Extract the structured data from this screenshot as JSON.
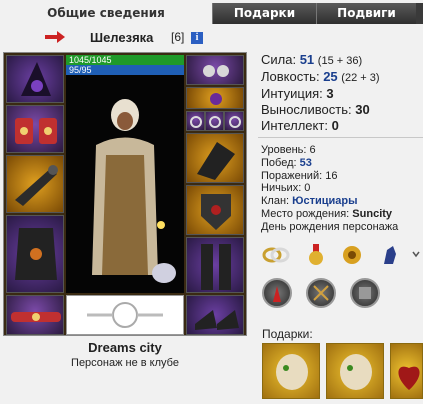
{
  "tabs": {
    "active": "Общие сведения",
    "gifts": "Подарки",
    "feats": "Подвиги"
  },
  "character": {
    "name": "Шелезяка",
    "level": "[6]",
    "info_icon": "i",
    "hp": "1045/1045",
    "mp": "95/95",
    "city": "Dreams city",
    "clan_status": "Персонаж не в клубе"
  },
  "stats": [
    {
      "label": "Сила:",
      "value": "51",
      "extra": "(15 + 36)"
    },
    {
      "label": "Ловкость:",
      "value": "25",
      "extra": "(22 + 3)"
    },
    {
      "label": "Интуиция:",
      "value": "3",
      "extra": ""
    },
    {
      "label": "Выносливость:",
      "value": "30",
      "extra": ""
    },
    {
      "label": "Интеллект:",
      "value": "0",
      "extra": ""
    }
  ],
  "info": {
    "level": "Уровень: 6",
    "wins_label": "Побед:",
    "wins": "53",
    "losses": "Поражений: 16",
    "draws": "Ничьих: 0",
    "clan_label": "Клан:",
    "clan": "Юстициары",
    "birthplace_label": "Место рождения:",
    "birthplace": "Suncity",
    "birthday": "День рождения персонажа"
  },
  "gifts_label": "Подарки:",
  "icons": {
    "arrow": "red-arrow-icon",
    "info": "info-icon",
    "badges": [
      "rings-badge-icon",
      "medal-badge-icon",
      "crest-badge-icon",
      "knight-badge-icon"
    ],
    "rounds": [
      "tower-icon",
      "swords-icon",
      "armor-icon"
    ],
    "gifts": [
      "gold-skull-gift-icon",
      "gold-skull-gift-icon",
      "red-heart-gift-icon"
    ]
  },
  "colors": {
    "hp": "#1f9a2a",
    "mp": "#1f5fb5",
    "accent": "#1a3f8e",
    "tab_dark": "#3a3a3a"
  }
}
